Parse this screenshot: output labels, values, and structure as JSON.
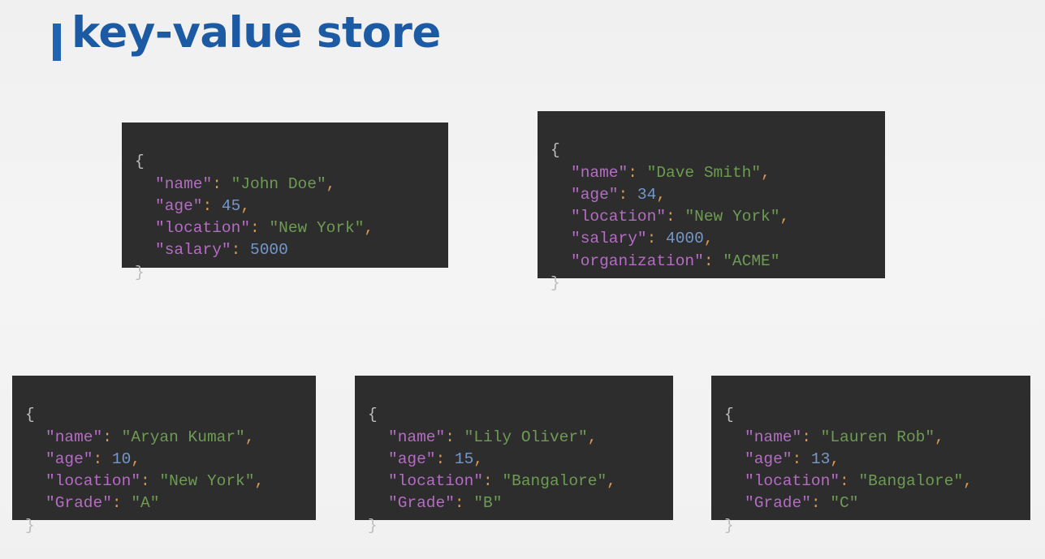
{
  "header": {
    "title": "key-value store"
  },
  "syntax_colors": {
    "background": "#2d2d2d",
    "key": "#b56cc4",
    "punctuation": "#d99853",
    "string": "#6e9b54",
    "number": "#7598cc",
    "brace": "#bdbdbd"
  },
  "records": [
    {
      "open": "{",
      "close": "}",
      "fields": [
        {
          "key": "\"name\"",
          "sep": ": ",
          "value": "\"John Doe\"",
          "type": "string",
          "comma": ","
        },
        {
          "key": "\"age\"",
          "sep": ": ",
          "value": "45",
          "type": "number",
          "comma": ","
        },
        {
          "key": "\"location\"",
          "sep": ": ",
          "value": "\"New York\"",
          "type": "string",
          "comma": ","
        },
        {
          "key": "\"salary\"",
          "sep": ": ",
          "value": "5000",
          "type": "number",
          "comma": ""
        }
      ]
    },
    {
      "open": "{",
      "close": "}",
      "fields": [
        {
          "key": "\"name\"",
          "sep": ": ",
          "value": "\"Dave Smith\"",
          "type": "string",
          "comma": ","
        },
        {
          "key": "\"age\"",
          "sep": ": ",
          "value": "34",
          "type": "number",
          "comma": ","
        },
        {
          "key": "\"location\"",
          "sep": ": ",
          "value": "\"New York\"",
          "type": "string",
          "comma": ","
        },
        {
          "key": "\"salary\"",
          "sep": ": ",
          "value": "4000",
          "type": "number",
          "comma": ","
        },
        {
          "key": "\"organization\"",
          "sep": ": ",
          "value": "\"ACME\"",
          "type": "string",
          "comma": ""
        }
      ]
    },
    {
      "open": "{",
      "close": "}",
      "fields": [
        {
          "key": "\"name\"",
          "sep": ": ",
          "value": "\"Aryan Kumar\"",
          "type": "string",
          "comma": ","
        },
        {
          "key": "\"age\"",
          "sep": ": ",
          "value": "10",
          "type": "number",
          "comma": ","
        },
        {
          "key": "\"location\"",
          "sep": ": ",
          "value": "\"New York\"",
          "type": "string",
          "comma": ","
        },
        {
          "key": "\"Grade\"",
          "sep": ": ",
          "value": "\"A\"",
          "type": "string",
          "comma": ""
        }
      ]
    },
    {
      "open": "{",
      "close": "}",
      "fields": [
        {
          "key": "\"name\"",
          "sep": ": ",
          "value": "\"Lily Oliver\"",
          "type": "string",
          "comma": ","
        },
        {
          "key": "\"age\"",
          "sep": ": ",
          "value": "15",
          "type": "number",
          "comma": ","
        },
        {
          "key": "\"location\"",
          "sep": ": ",
          "value": "\"Bangalore\"",
          "type": "string",
          "comma": ","
        },
        {
          "key": "\"Grade\"",
          "sep": ": ",
          "value": "\"B\"",
          "type": "string",
          "comma": ""
        }
      ]
    },
    {
      "open": "{",
      "close": "}",
      "fields": [
        {
          "key": "\"name\"",
          "sep": ": ",
          "value": "\"Lauren Rob\"",
          "type": "string",
          "comma": ","
        },
        {
          "key": "\"age\"",
          "sep": ": ",
          "value": "13",
          "type": "number",
          "comma": ","
        },
        {
          "key": "\"location\"",
          "sep": ": ",
          "value": "\"Bangalore\"",
          "type": "string",
          "comma": ","
        },
        {
          "key": "\"Grade\"",
          "sep": ": ",
          "value": "\"C\"",
          "type": "string",
          "comma": ""
        }
      ]
    }
  ]
}
